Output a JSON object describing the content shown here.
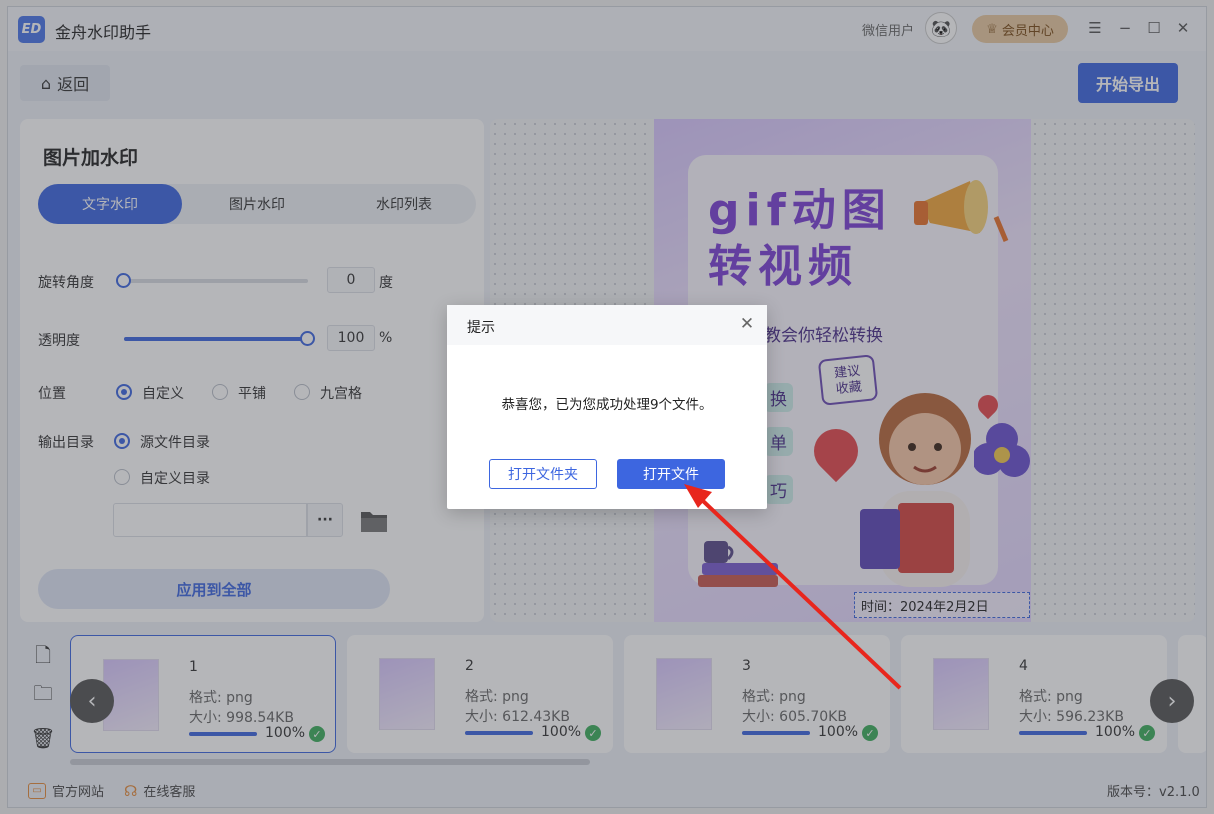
{
  "titlebar": {
    "app_logo": "ED",
    "app_title": "金舟水印助手",
    "user_name": "微信用户",
    "vip_label": "会员中心",
    "minimize": "−",
    "maximize": "☐",
    "close": "✕"
  },
  "toolbar": {
    "back_label": "返回",
    "export_label": "开始导出"
  },
  "panel": {
    "title": "图片加水印",
    "tabs": [
      "文字水印",
      "图片水印",
      "水印列表"
    ],
    "rotation": {
      "label": "旋转角度",
      "value": "0",
      "unit": "度",
      "level": 0
    },
    "opacity": {
      "label": "透明度",
      "value": "100",
      "unit": "%",
      "level": 1
    },
    "position": {
      "label": "位置",
      "options": [
        "自定义",
        "平铺",
        "九宫格"
      ],
      "selected": "自定义"
    },
    "output": {
      "label": "输出目录",
      "options": [
        "源文件目录",
        "自定义目录"
      ],
      "selected": "源文件目录",
      "path_value": ""
    },
    "dots_label": "···",
    "apply_label": "应用到全部"
  },
  "preview": {
    "poster_title_line1": "gif动图",
    "poster_title_line2": "转视频",
    "poster_subtitle": "教会你轻松转换",
    "tags": [
      "换",
      "单",
      "巧"
    ],
    "bubble": [
      "建议",
      "收藏"
    ],
    "watermark_text": "时间：2024年2月2日"
  },
  "files": [
    {
      "num": "1",
      "format": "格式: png",
      "size": "大小: 998.54KB",
      "progress": "100%",
      "level": 1
    },
    {
      "num": "2",
      "format": "格式: png",
      "size": "大小: 612.43KB",
      "progress": "100%",
      "level": 1
    },
    {
      "num": "3",
      "format": "格式: png",
      "size": "大小: 605.70KB",
      "progress": "100%",
      "level": 1
    },
    {
      "num": "4",
      "format": "格式: png",
      "size": "大小: 596.23KB",
      "progress": "100%",
      "level": 1
    }
  ],
  "footer": {
    "website": "官方网站",
    "support": "在线客服",
    "version": "版本号：v2.1.0"
  },
  "dialog": {
    "title": "提示",
    "message": "恭喜您，已为您成功处理9个文件。",
    "open_folder": "打开文件夹",
    "open_file": "打开文件"
  },
  "colors": {
    "accent": "#3d66e0",
    "annotation_arrow": "#e8261d"
  }
}
